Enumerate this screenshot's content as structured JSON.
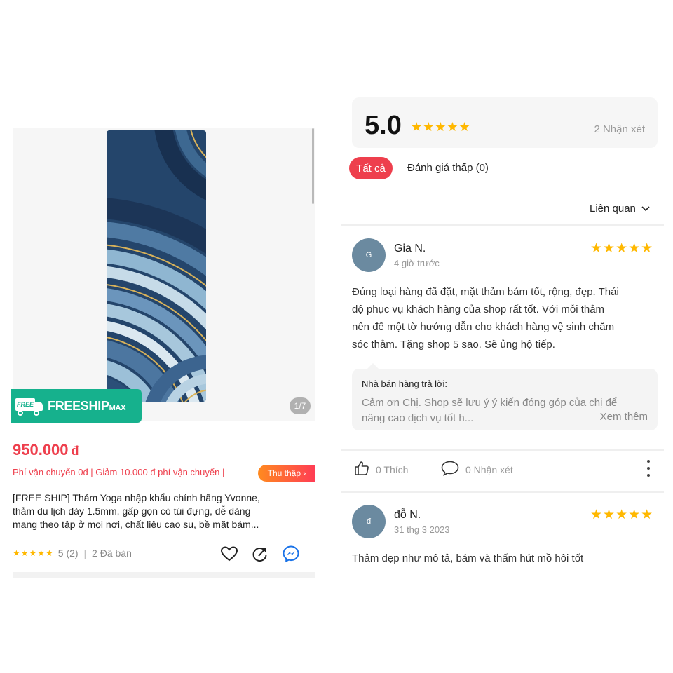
{
  "product": {
    "image_counter": "1/7",
    "badge": {
      "truck_text": "FREE",
      "main": "FREESHIP",
      "suffix": "MAX"
    },
    "price": "950.000",
    "currency": "đ",
    "shipping_info": "Phí vận chuyển 0đ | Giảm 10.000 đ phí vận chuyển |",
    "collect_label": "Thu thập ›",
    "title_lines": [
      "[FREE SHIP] Thảm Yoga nhập khẩu chính hãng  Yvonne,",
      "thảm du lịch dày 1.5mm, gấp gọn có túi đựng, dễ dàng",
      "mang theo tập ở mọi nơi, chất liệu cao su, bề mặt bám..."
    ],
    "rating_stars": "★★★★★",
    "rating_value": "5",
    "rating_count": "(2)",
    "sold": "2 Đã bán",
    "icons": [
      "heart-icon",
      "share-icon",
      "messenger-icon"
    ]
  },
  "reviews": {
    "score": "5.0",
    "stars": "★★★★★",
    "count_label": "2 Nhận xét",
    "filters": {
      "all": "Tất cả",
      "low": "Đánh giá thấp (0)"
    },
    "sort_label": "Liên quan",
    "items": [
      {
        "avatar": "G",
        "name": "Gia N.",
        "time": "4 giờ trước",
        "stars": "★★★★★",
        "body_lines": [
          "Đúng loại hàng đã đặt, mặt thảm bám tốt, rộng, đẹp. Thái",
          "độ phục vụ khách hàng của shop rất tốt. Với mỗi thảm",
          "nên để một tờ hướng dẫn cho khách hàng vệ sinh chăm",
          "sóc thảm. Tặng shop 5 sao. Sẽ ủng hộ tiếp."
        ],
        "reply": {
          "label": "Nhà bán hàng trả lời:",
          "lines": [
            "Cảm ơn Chị. Shop sẽ lưu ý ý kiến đóng góp của chị để",
            "nâng cao dịch vụ tốt h..."
          ],
          "see_more": "Xem thêm"
        },
        "like_label": "0 Thích",
        "comment_label": "0 Nhận xét"
      },
      {
        "avatar": "đ",
        "name": "đỗ N.",
        "time": "31 thg 3 2023",
        "stars": "★★★★★",
        "body_lines": [
          "Thảm đẹp như mô tả, bám và thấm hút mồ hôi tốt"
        ]
      }
    ]
  },
  "colors": {
    "accent_red": "#ee3f4d",
    "star_yellow": "#ffb800",
    "freeship_green": "#16b18d",
    "avatar_bg": "#6b8aa0"
  }
}
